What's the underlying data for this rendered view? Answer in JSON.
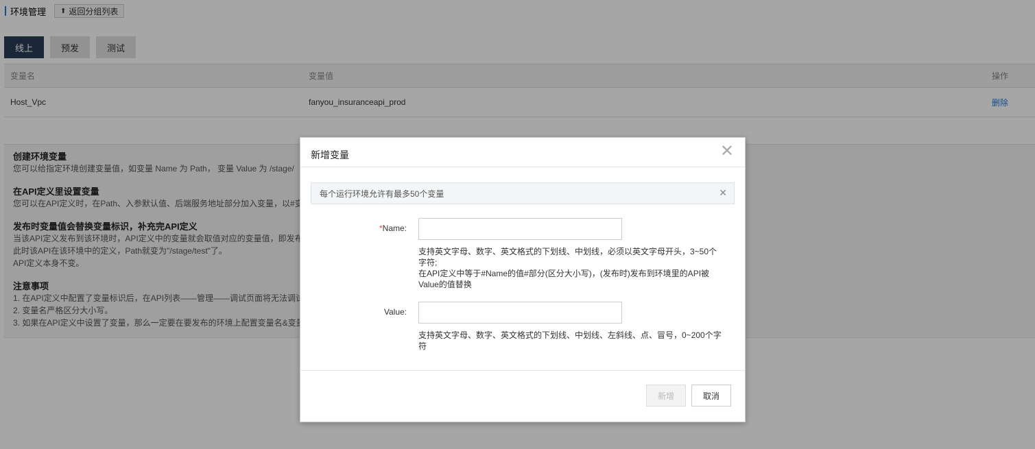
{
  "header": {
    "title": "环境管理",
    "back_label": "返回分组列表"
  },
  "tabs": [
    {
      "label": "线上",
      "active": true
    },
    {
      "label": "预发",
      "active": false
    },
    {
      "label": "测试",
      "active": false
    }
  ],
  "table": {
    "columns": [
      "变量名",
      "变量值",
      "操作"
    ],
    "rows": [
      {
        "name": "Host_Vpc",
        "value": "fanyou_insuranceapi_prod",
        "action": "删除"
      }
    ]
  },
  "help": {
    "sections": [
      {
        "title": "创建环境变量",
        "lines": [
          "您可以给指定环境创建变量值，如变量 Name 为 Path， 变量 Value 为 /stage/"
        ]
      },
      {
        "title": "在API定义里设置变量",
        "lines": [
          "您可以在API定义时，在Path、入参默认值、后端服务地址部分加入变量，以#变"
        ]
      },
      {
        "title": "发布时变量值会替换变量标识，补充完API定义",
        "lines": [
          "当该API定义发布到该环境时，API定义中的变量就会取值对应的变量值，即发布",
          "此时该API在该环境中的定义，Path就变为\"/stage/test\"了。",
          "API定义本身不变。"
        ]
      },
      {
        "title": "注意事项",
        "lines": [
          "1. 在API定义中配置了变量标识后，在API列表——管理——调试页面将无法调试",
          "2. 变量名严格区分大小写。",
          "3. 如果在API定义中设置了变量，那么一定要在要发布的环境上配置变量名&变量"
        ]
      }
    ]
  },
  "modal": {
    "title": "新增变量",
    "notice": "每个运行环境允许有最多50个变量",
    "name_required_mark": "*",
    "name_label": "Name:",
    "name_value": "",
    "name_hint_1": "支持英文字母、数字、英文格式的下划线、中划线，必须以英文字母开头，3~50个字符;",
    "name_hint_2": "在API定义中等于#Name的值#部分(区分大小写)，(发布时)发布到环境里的API被Value的值替换",
    "value_label": "Value:",
    "value_value": "",
    "value_hint": "支持英文字母、数字、英文格式的下划线、中划线、左斜线、点、冒号，0~200个字符",
    "add_label": "新增",
    "cancel_label": "取消"
  }
}
